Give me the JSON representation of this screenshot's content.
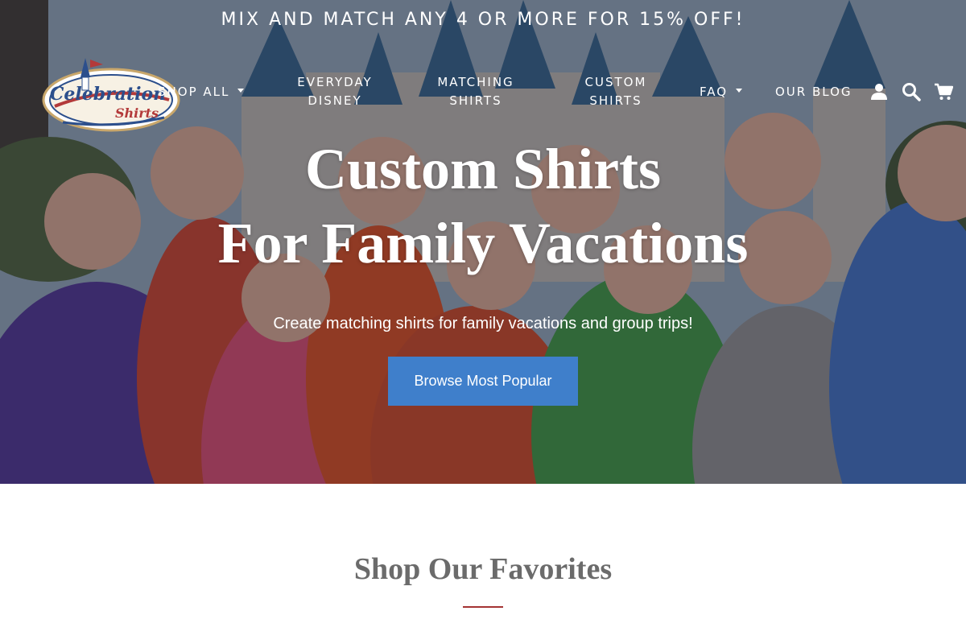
{
  "announcement": {
    "text": "MIX AND MATCH ANY 4 OR MORE FOR 15% OFF!"
  },
  "logo": {
    "line1": "Celebration",
    "line2": "Shirts",
    "icon": "celebration-shirts-logo"
  },
  "nav": {
    "shop_all": "SHOP ALL",
    "everyday_disney": [
      "EVERYDAY",
      "DISNEY"
    ],
    "matching_shirts": [
      "MATCHING",
      "SHIRTS"
    ],
    "custom_shirts": [
      "CUSTOM",
      "SHIRTS"
    ],
    "faq": "FAQ",
    "our_blog": "OUR BLOG",
    "icons": [
      "account-icon",
      "search-icon",
      "cart-icon"
    ]
  },
  "hero": {
    "title_line1": "Custom Shirts",
    "title_line2": "For Family Vacations",
    "subtitle": "Create matching shirts for family vacations and group trips!",
    "cta_label": "Browse Most Popular",
    "cta_color": "#3f7fcb"
  },
  "favorites": {
    "title": "Shop Our Favorites",
    "rule_color": "#a43333"
  }
}
